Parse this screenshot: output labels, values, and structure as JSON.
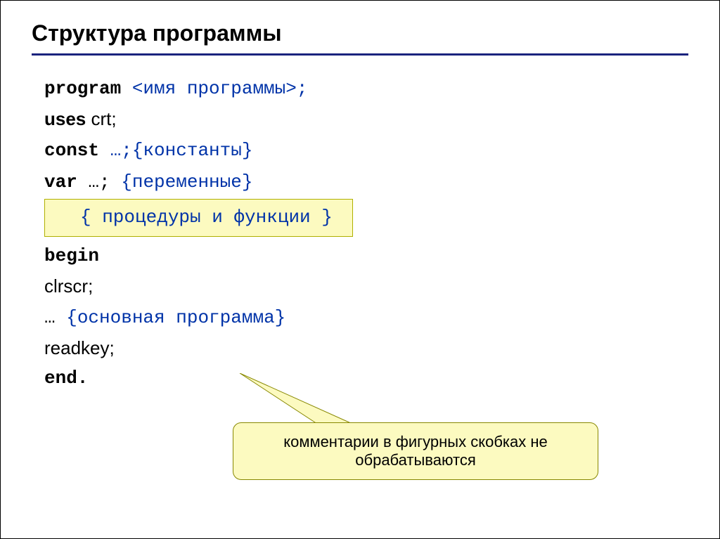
{
  "title": "Структура программы",
  "code": {
    "l1_kw": "program",
    "l1_rest": " <имя программы>;",
    "l2_kw": "uses",
    "l2_rest": " crt;",
    "l3_kw": "const",
    "l3_rest": " …;{константы}",
    "l4_kw": "var",
    "l4_rest": " …; ",
    "l4_comment": "{переменные}",
    "box": "{ процедуры и функции }",
    "l5": "begin",
    "l6": "clrscr",
    "l6_semi": ";",
    "l7_pre": " … ",
    "l7_comment": "{основная программа}",
    "l8": "readkey",
    "l8_semi": ";",
    "l9": "end."
  },
  "callout": "комментарии в фигурных скобках не обрабатываются"
}
